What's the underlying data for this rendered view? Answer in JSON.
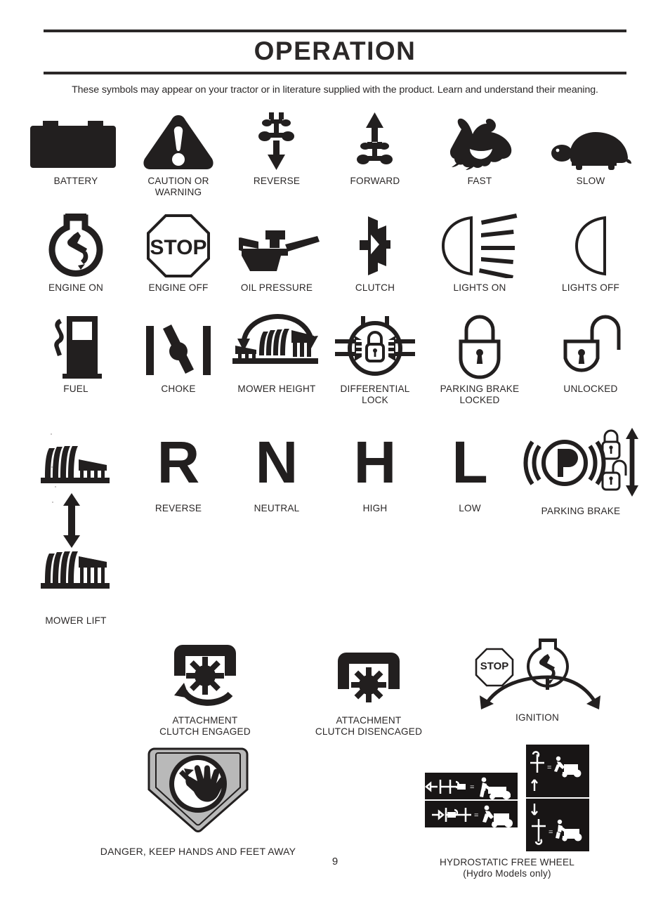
{
  "header": {
    "title": "OPERATION",
    "intro": "These symbols may appear on your tractor or in literature supplied with the product.  Learn and understand their meaning."
  },
  "rows": [
    {
      "id": "row-1",
      "items": [
        {
          "key": "battery",
          "label": "BATTERY",
          "icon": "battery-icon"
        },
        {
          "key": "caution",
          "label": "CAUTION OR\nWARNING",
          "icon": "warning-triangle-icon"
        },
        {
          "key": "reverse",
          "label": "REVERSE",
          "icon": "tractor-reverse-icon"
        },
        {
          "key": "forward",
          "label": "FORWARD",
          "icon": "tractor-forward-icon"
        },
        {
          "key": "fast",
          "label": "FAST",
          "icon": "rabbit-icon"
        },
        {
          "key": "slow",
          "label": "SLOW",
          "icon": "turtle-icon"
        }
      ]
    },
    {
      "id": "row-2",
      "items": [
        {
          "key": "engine-on",
          "label": "ENGINE ON",
          "icon": "engine-on-icon"
        },
        {
          "key": "engine-off",
          "label": "ENGINE OFF",
          "icon": "stop-octagon-icon",
          "text": "STOP"
        },
        {
          "key": "oil-pressure",
          "label": "OIL PRESSURE",
          "icon": "oil-can-icon"
        },
        {
          "key": "clutch",
          "label": "CLUTCH",
          "icon": "clutch-icon"
        },
        {
          "key": "lights-on",
          "label": "LIGHTS ON",
          "icon": "headlight-on-icon"
        },
        {
          "key": "lights-off",
          "label": "LIGHTS OFF",
          "icon": "headlight-off-icon"
        }
      ]
    },
    {
      "id": "row-3",
      "items": [
        {
          "key": "fuel",
          "label": "FUEL",
          "icon": "fuel-pump-icon"
        },
        {
          "key": "choke",
          "label": "CHOKE",
          "icon": "choke-icon"
        },
        {
          "key": "mower-height",
          "label": "MOWER HEIGHT",
          "icon": "mower-height-icon"
        },
        {
          "key": "diff-lock",
          "label": "DIFFERENTIAL\nLOCK",
          "icon": "differential-lock-icon"
        },
        {
          "key": "pb-locked",
          "label": "PARKING BRAKE\nLOCKED",
          "icon": "padlock-closed-icon"
        },
        {
          "key": "unlocked",
          "label": "UNLOCKED",
          "icon": "padlock-open-icon"
        }
      ]
    },
    {
      "id": "row-4",
      "items": [
        {
          "key": "mower-lift",
          "label": "MOWER LIFT",
          "icon": "mower-lift-icon"
        },
        {
          "key": "gear-reverse",
          "label": "REVERSE",
          "icon": "letter-r",
          "text": "R"
        },
        {
          "key": "gear-neutral",
          "label": "NEUTRAL",
          "icon": "letter-n",
          "text": "N"
        },
        {
          "key": "gear-high",
          "label": "HIGH",
          "icon": "letter-h",
          "text": "H"
        },
        {
          "key": "gear-low",
          "label": "LOW",
          "icon": "letter-l",
          "text": "L"
        },
        {
          "key": "parking-brake",
          "label": "PARKING BRAKE",
          "icon": "parking-brake-icon"
        }
      ]
    },
    {
      "id": "row-5",
      "items": [
        {
          "key": "attach-engaged",
          "label": "ATTACHMENT\nCLUTCH ENGAGED",
          "icon": "attachment-clutch-engaged-icon"
        },
        {
          "key": "attach-disengaged",
          "label": "ATTACHMENT\nCLUTCH DISENCAGED",
          "icon": "attachment-clutch-disengaged-icon"
        },
        {
          "key": "ignition",
          "label": "IGNITION",
          "icon": "ignition-switch-icon",
          "text": "STOP"
        }
      ]
    }
  ],
  "bottom": {
    "danger": {
      "label": "DANGER, KEEP HANDS AND FEET AWAY",
      "icon": "keep-hands-away-icon"
    },
    "hydrostatic": {
      "label": "HYDROSTATIC FREE WHEEL",
      "sublabel": "(Hydro Models only)",
      "icon": "hydrostatic-free-wheel-decal"
    }
  },
  "footer": {
    "page_number": "9"
  },
  "colors": {
    "ink": "#221f1f",
    "rule": "#2b2828",
    "decal_background": "#181515",
    "decal_foreground": "#ffffff",
    "danger_fill": "#b9b9b9"
  }
}
